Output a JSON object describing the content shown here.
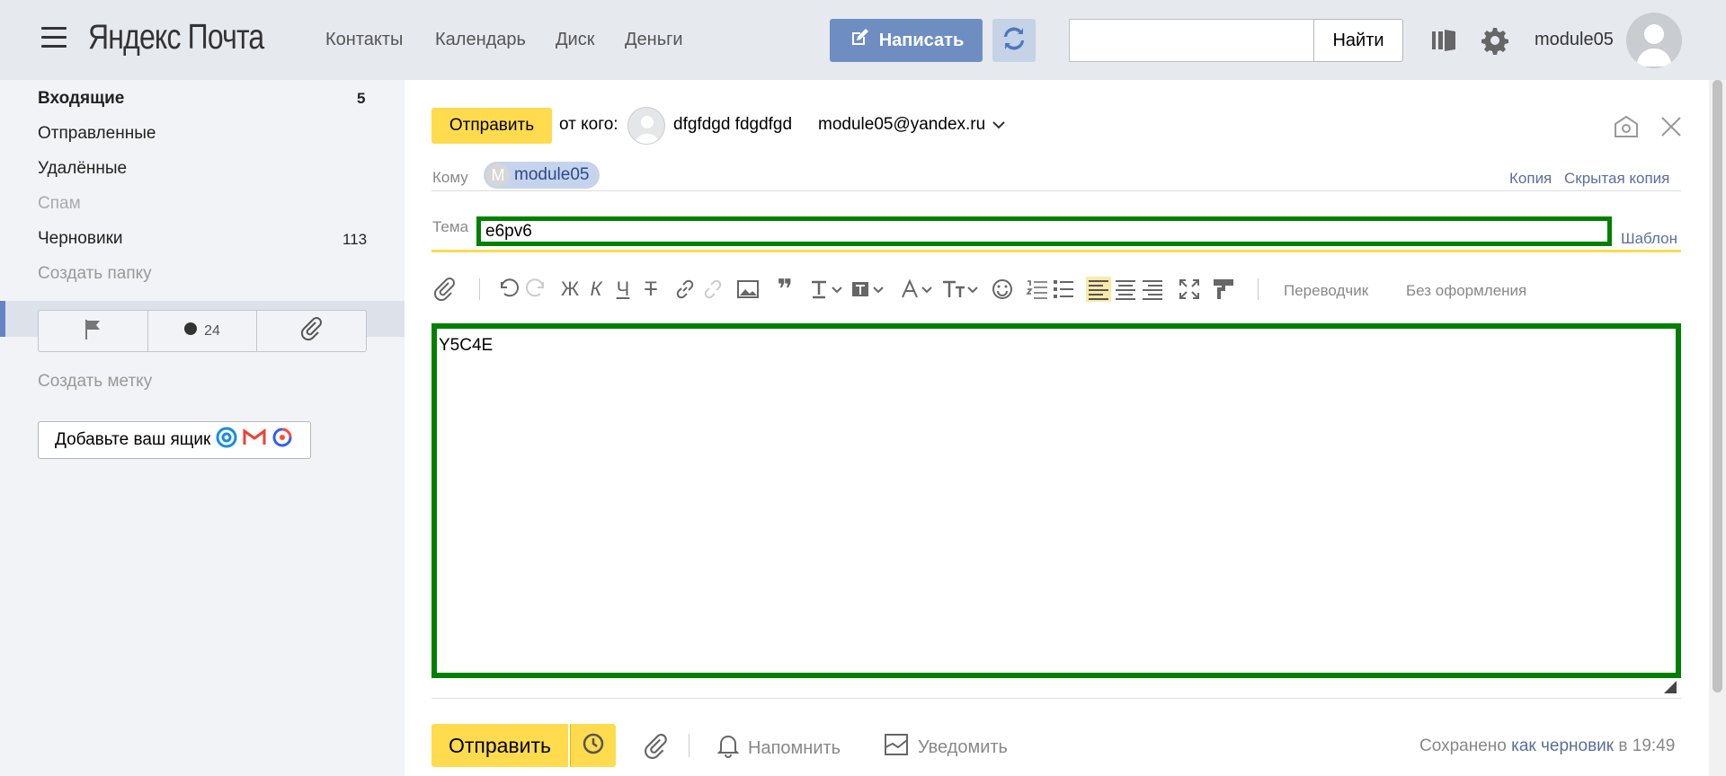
{
  "header": {
    "logo": "Яндекс Почта",
    "nav": [
      "Контакты",
      "Календарь",
      "Диск",
      "Деньги"
    ],
    "compose_label": "Написать",
    "search_value": "",
    "search_button": "Найти",
    "username": "module05",
    "icons": [
      "menu-icon",
      "compose-pencil-icon",
      "refresh-icon",
      "layout-icon",
      "gear-icon",
      "avatar"
    ]
  },
  "sidebar": {
    "folders": [
      {
        "label": "Входящие",
        "count": "5",
        "bold": true
      },
      {
        "label": "Отправленные",
        "count": ""
      },
      {
        "label": "Удалённые",
        "count": ""
      },
      {
        "label": "Спам",
        "count": "",
        "muted": true
      },
      {
        "label": "Черновики",
        "count": "113",
        "active": true
      },
      {
        "label": "Создать папку",
        "count": "",
        "muted": true
      }
    ],
    "labels_unread_count": "24",
    "create_label": "Создать метку",
    "add_mailbox": "Добавьте ваш ящик"
  },
  "compose": {
    "send_label": "Отправить",
    "from_label": "от кого:",
    "from_name": "dfgfdgd fdgdfgd",
    "from_email": "module05@yandex.ru",
    "to_label": "Кому",
    "to_chip": "module05",
    "to_chip_initial": "M",
    "cc_label": "Копия",
    "bcc_label": "Скрытая копия",
    "subject_label": "Тема",
    "subject_value": "e6pv6",
    "template_label": "Шаблон",
    "translator_label": "Переводчик",
    "plain_label": "Без оформления",
    "body_text": "Y5C4E",
    "bottom_send_label": "Отправить",
    "remind_label": "Напомнить",
    "notify_label": "Уведомить",
    "saved_prefix": "Сохранено",
    "saved_link": "как черновик",
    "saved_suffix": "в 19:49"
  },
  "colors": {
    "header_bg": "#e6e9ee",
    "sidebar_bg": "#f1f3f6",
    "accent_yellow": "#ffdb4d",
    "compose_blue": "#6e8ec2",
    "highlight_green": "#008000",
    "link_blue": "#5a6e9c"
  }
}
